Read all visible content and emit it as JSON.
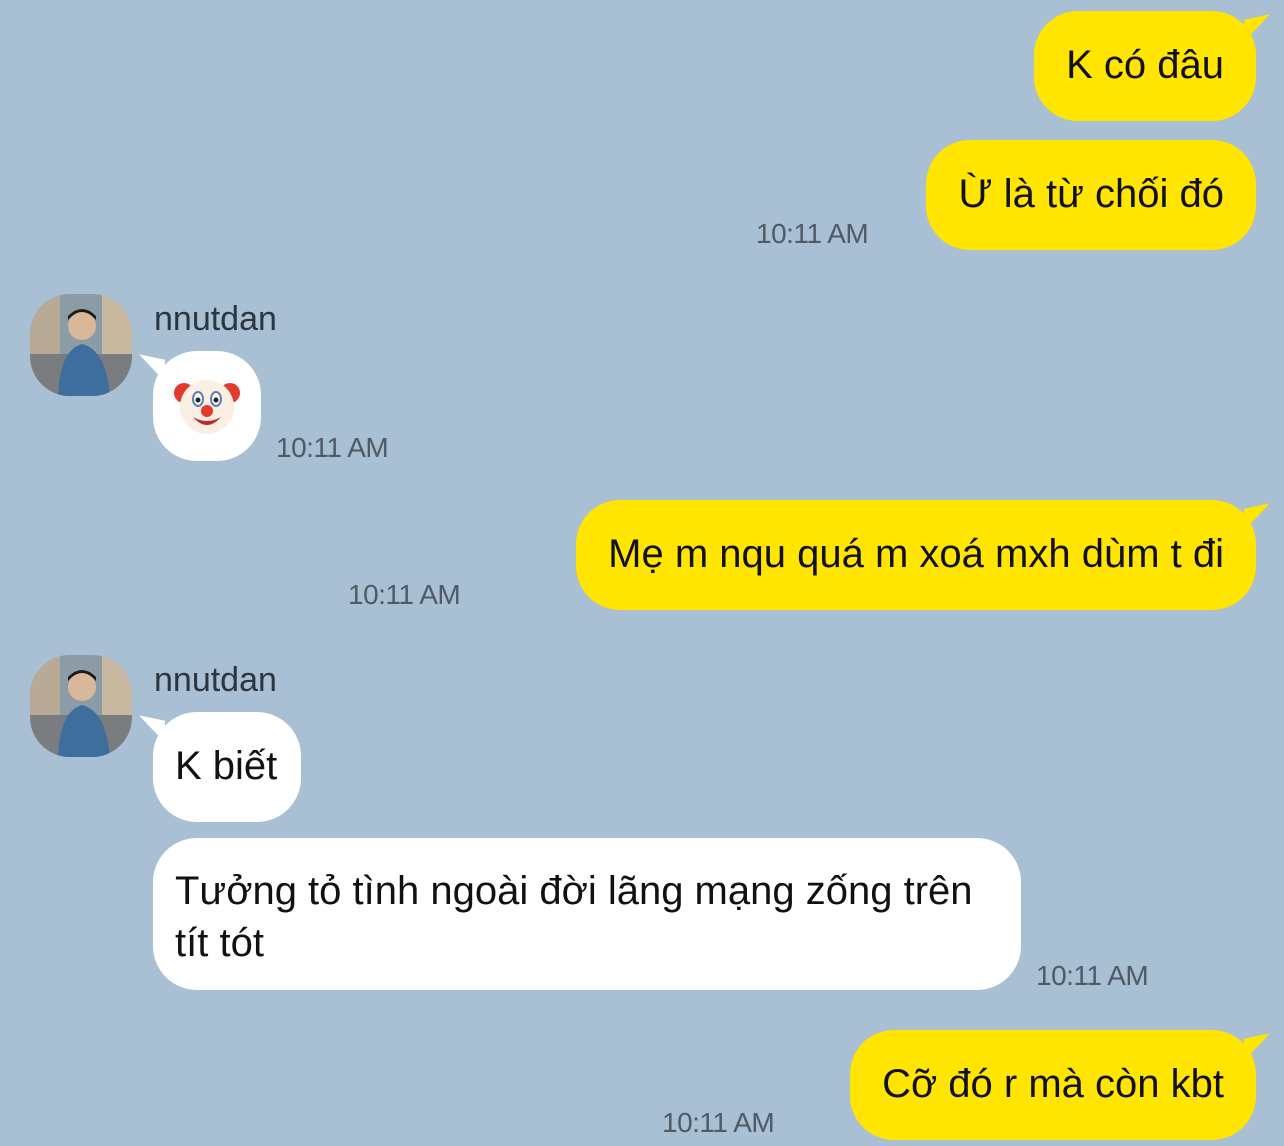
{
  "messages": [
    {
      "from": "me",
      "text": "K có đâu"
    },
    {
      "from": "me",
      "text": "Ừ là từ chối đó",
      "time": "10:11 AM"
    },
    {
      "from": "nnutdan",
      "sender": "nnutdan",
      "text": "🤡",
      "time": "10:11 AM"
    },
    {
      "from": "me",
      "text": "Mẹ m nqu quá m xoá mxh dùm t đi",
      "time": "10:11 AM"
    },
    {
      "from": "nnutdan",
      "sender": "nnutdan",
      "text": "K biết"
    },
    {
      "from": "nnutdan",
      "text": "Tưởng tỏ tình ngoài đời lãng mạng zống trên tít tót",
      "time": "10:11 AM"
    },
    {
      "from": "me",
      "text": "Cỡ đó r mà còn kbt",
      "time": "10:11 AM"
    }
  ],
  "colors": {
    "background": "#a9bfd3",
    "outgoing_bubble": "#ffe500",
    "incoming_bubble": "#ffffff"
  },
  "icons": {
    "avatar": "profile-photo-avatar",
    "clown": "clown-face-emoji"
  }
}
